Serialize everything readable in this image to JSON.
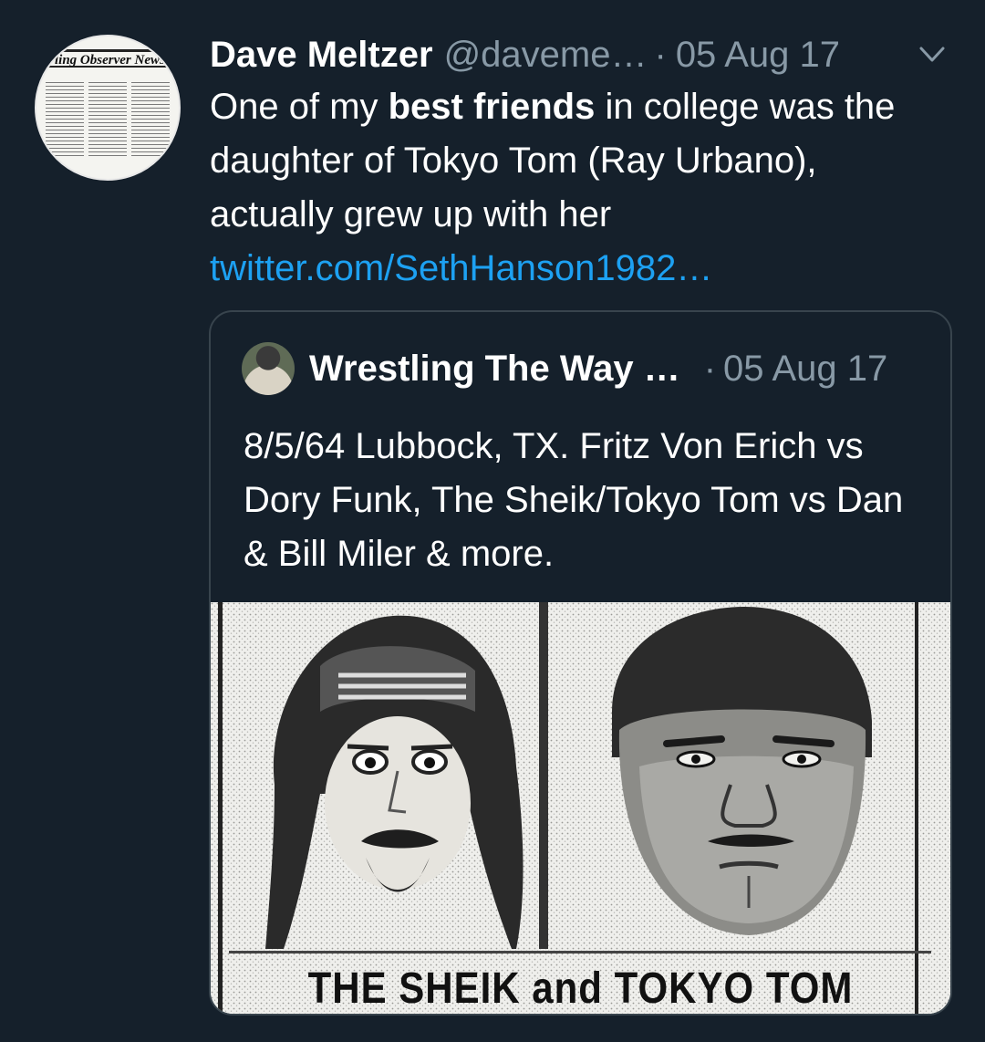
{
  "tweet": {
    "author_name": "Dave Meltzer",
    "author_handle": "@daveme…",
    "separator": "·",
    "date": "05 Aug 17",
    "text_pre": "One of my ",
    "text_bold": "best friends",
    "text_post": " in college was the daughter of Tokyo Tom (Ray Urbano), actually grew up with her ",
    "link": "twitter.com/SethHanson1982…",
    "avatar_masthead": "ling Observer News",
    "menu_icon": "chevron-down-icon"
  },
  "quoted": {
    "author_name": "Wrestling The Way …",
    "separator": "·",
    "date": "05 Aug 17",
    "text": "8/5/64 Lubbock, TX. Fritz Von Erich vs Dory Funk, The Sheik/Tokyo Tom vs Dan & Bill Miler & more.",
    "image_caption": "THE SHEIK and TOKYO TOM"
  },
  "colors": {
    "background": "#15202b",
    "text_primary": "#ffffff",
    "text_secondary": "#8899a6",
    "link": "#1da1f2",
    "card_border": "#38444d"
  }
}
